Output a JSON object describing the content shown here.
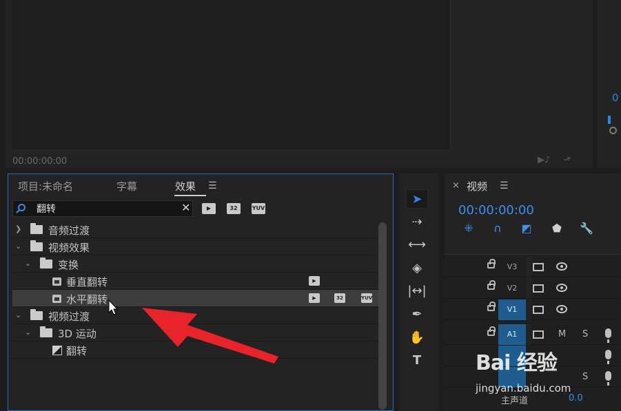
{
  "program_monitor": {
    "timecode": "00:00:00:00"
  },
  "right_monitor": {
    "timecode_partial": "0"
  },
  "effects_panel": {
    "tabs": [
      {
        "label": "项目:未命名",
        "active": false
      },
      {
        "label": "字幕",
        "active": false
      },
      {
        "label": "效果",
        "active": true
      }
    ],
    "menu_icon": "hamburger-icon",
    "search": {
      "value": "翻转",
      "clear_label": "✕"
    },
    "filter_badges": [
      "accelerated-effects-icon",
      "32-bit-icon",
      "yuv-icon"
    ],
    "badge_text": {
      "b32": "32",
      "yuv": "YUV"
    },
    "tree": [
      {
        "label": "音频过渡",
        "type": "folder",
        "level": 0,
        "expanded": false
      },
      {
        "label": "视频效果",
        "type": "folder",
        "level": 0,
        "expanded": true
      },
      {
        "label": "变换",
        "type": "folder",
        "level": 1,
        "expanded": true
      },
      {
        "label": "垂直翻转",
        "type": "effect",
        "level": 2
      },
      {
        "label": "水平翻转",
        "type": "effect",
        "level": 2,
        "selected": true
      },
      {
        "label": "视频过渡",
        "type": "folder",
        "level": 0,
        "expanded": true
      },
      {
        "label": "3D 运动",
        "type": "folder",
        "level": 1,
        "expanded": true
      },
      {
        "label": "翻转",
        "type": "transition",
        "level": 2
      }
    ]
  },
  "tools": [
    "selection-tool-icon",
    "track-select-forward-icon",
    "ripple-edit-icon",
    "razor-icon",
    "slip-icon",
    "pen-icon",
    "hand-icon",
    "type-tool-icon"
  ],
  "timeline": {
    "close_label": "×",
    "title": "视频",
    "timecode": "00:00:00:00",
    "tracks": [
      {
        "name": "V3",
        "targeted": false,
        "kind": "video"
      },
      {
        "name": "V2",
        "targeted": false,
        "kind": "video"
      },
      {
        "name": "V1",
        "targeted": true,
        "kind": "video"
      },
      {
        "name": "A1",
        "targeted": true,
        "kind": "audio",
        "m": "M",
        "s": "S"
      }
    ],
    "master": {
      "label": "主声道",
      "value": "0.0"
    }
  },
  "colors": {
    "accent_blue": "#2f84e6",
    "annotation_red": "#e8232a",
    "track_target": "#1f5c8f"
  },
  "watermark": {
    "logo": "Bai 经验",
    "url": "jingyan.baidu.com"
  }
}
